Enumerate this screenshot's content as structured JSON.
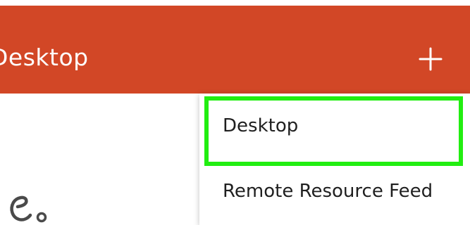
{
  "appbar": {
    "title": "Desktop",
    "add_icon": "plus-icon",
    "color": "#d24726"
  },
  "menu": {
    "items": [
      {
        "label": "Desktop",
        "highlighted": true
      },
      {
        "label": "Remote Resource Feed",
        "highlighted": false
      }
    ]
  },
  "highlight": {
    "color": "#22ee11"
  },
  "background_text_fragment": "e."
}
